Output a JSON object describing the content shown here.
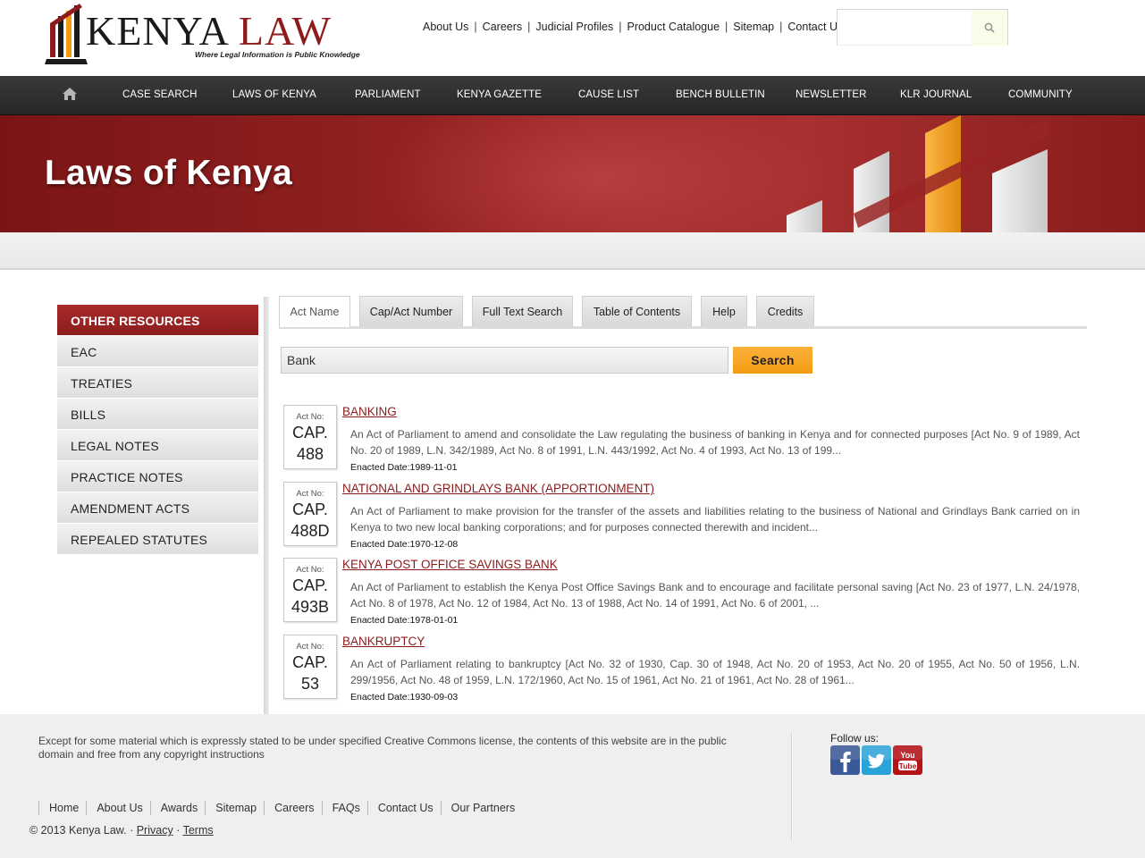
{
  "brand": {
    "name_dark": "KENYA",
    "name_red": "LAW",
    "tagline": "Where Legal Information is Public Knowledge"
  },
  "toplinks": [
    "About Us",
    "Careers",
    "Judicial Profiles",
    "Product Catalogue",
    "Sitemap",
    "Contact Us"
  ],
  "site_search": {
    "value": "",
    "icon": "search-icon"
  },
  "nav": {
    "home_icon": "home-icon",
    "items": [
      "CASE SEARCH",
      "LAWS OF KENYA",
      "PARLIAMENT",
      "KENYA GAZETTE",
      "CAUSE LIST",
      "BENCH BULLETIN",
      "NEWSLETTER",
      "KLR JOURNAL",
      "COMMUNITY"
    ]
  },
  "banner": {
    "title": "Laws of Kenya"
  },
  "sidebar": {
    "heading": "OTHER RESOURCES",
    "items": [
      "EAC",
      "TREATIES",
      "BILLS",
      "LEGAL NOTES",
      "PRACTICE NOTES",
      "AMENDMENT ACTS",
      "REPEALED STATUTES"
    ]
  },
  "tabs": [
    "Act Name",
    "Cap/Act Number",
    "Full Text Search",
    "Table of Contents",
    "Help",
    "Credits"
  ],
  "active_tab": "Act Name",
  "search": {
    "value": "Bank",
    "button": "Search"
  },
  "results": [
    {
      "cap_label": "Act No:",
      "cap_line1": "CAP.",
      "cap_line2": "488",
      "title": "BANKING",
      "description": "An Act of Parliament to amend and consolidate the Law regulating the business of banking in Kenya and for connected purposes [Act No. 9 of 1989, Act No. 20 of 1989, L.N. 342/1989, Act No. 8 of 1991, L.N. 443/1992, Act No. 4 of 1993, Act No. 13 of 199...",
      "date": "Enacted Date:1989-11-01"
    },
    {
      "cap_label": "Act No:",
      "cap_line1": "CAP.",
      "cap_line2": "488D",
      "title": "NATIONAL AND GRINDLAYS BANK (APPORTIONMENT)",
      "description": "An Act of Parliament to make provision for the transfer of the assets and liabilities relating to the business of National and Grindlays Bank carried on in Kenya to two new local banking corporations; and for purposes connected therewith and incident...",
      "date": "Enacted Date:1970-12-08"
    },
    {
      "cap_label": "Act No:",
      "cap_line1": "CAP.",
      "cap_line2": "493B",
      "title": "KENYA POST OFFICE SAVINGS BANK",
      "description": "An Act of Parliament to establish the Kenya Post Office Savings Bank and to encourage and facilitate personal saving [Act No. 23 of 1977, L.N. 24/1978, Act No. 8 of 1978, Act No. 12 of 1984, Act No. 13 of 1988, Act No. 14 of 1991, Act No. 6 of 2001, ...",
      "date": "Enacted Date:1978-01-01"
    },
    {
      "cap_label": "Act No:",
      "cap_line1": "CAP.",
      "cap_line2": "53",
      "title": "BANKRUPTCY",
      "description": "An Act of Parliament relating to bankruptcy [Act No. 32 of 1930, Cap. 30 of 1948, Act No. 20 of 1953, Act No. 20 of 1955, Act No. 50 of 1956, L.N. 299/1956, Act No. 48 of 1959, L.N. 172/1960, Act No. 15 of 1961, Act No. 21 of 1961, Act No. 28 of 1961...",
      "date": "Enacted Date:1930-09-03"
    }
  ],
  "footer": {
    "note": "Except for some material which is expressly stated to be under specified Creative Commons license, the contents of this website are in the public domain and free from any copyright instructions",
    "follow_label": "Follow us:",
    "social": [
      {
        "icon": "facebook-icon",
        "color": "#3b5998"
      },
      {
        "icon": "twitter-icon",
        "color": "#1da1f2"
      },
      {
        "icon": "youtube-icon",
        "color": "#b31217"
      }
    ],
    "links": [
      "Home",
      "About Us",
      "Awards",
      "Sitemap",
      "Careers",
      "FAQs",
      "Contact Us",
      "Our Partners"
    ],
    "copyright": "© 2013 Kenya Law. ·",
    "privacy": "Privacy",
    "terms": "Terms"
  },
  "colors": {
    "brand_red": "#8e1b1b",
    "nav_dark": "#2e2e2e",
    "search_button": "#f7a21b",
    "link_red": "#8b1a1a"
  }
}
